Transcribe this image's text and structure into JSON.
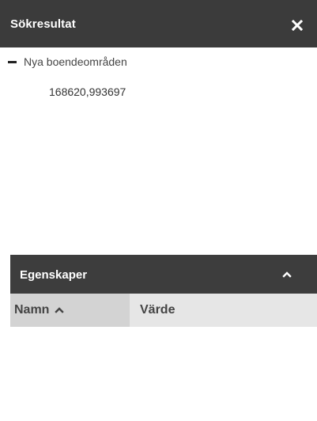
{
  "results": {
    "title": "Sökresultat",
    "close_icon": "close-icon",
    "group": {
      "icon": "collapse-minus-icon",
      "label": "Nya boendeområden",
      "items": [
        "168620,993697"
      ]
    }
  },
  "properties": {
    "title": "Egenskaper",
    "toggle_icon": "chevron-up-icon",
    "columns": {
      "name": "Namn",
      "name_sort_icon": "sort-ascending-icon",
      "value": "Värde"
    },
    "rows": []
  },
  "colors": {
    "header_bg": "#3b3b3b",
    "sorted_column_bg": "#d3d3d3",
    "column_bg": "#e6e6e6"
  }
}
